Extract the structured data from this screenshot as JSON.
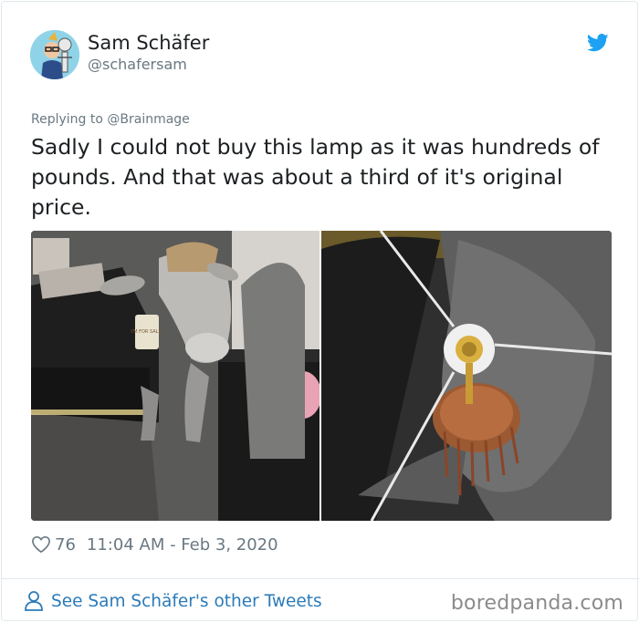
{
  "tweet": {
    "author": {
      "display_name": "Sam Schäfer",
      "handle": "@schafersam",
      "avatar": "avatar-illustration"
    },
    "replying_to": "Replying to @Brainmage",
    "text": "Sadly I could not buy this lamp as it was hundreds of pounds. And that was about a third of it's original price.",
    "media": [
      {
        "icon": "photo-cow-statue",
        "tag_text": "I'M FOR SALE!"
      },
      {
        "icon": "photo-lamp-from-below"
      }
    ],
    "likes": "76",
    "timestamp": "11:04 AM - Feb 3, 2020",
    "icons": {
      "brand": "twitter-bird-icon",
      "like": "heart-icon",
      "profile": "person-icon"
    }
  },
  "footer": {
    "other_tweets_link": "See Sam Schäfer's other Tweets"
  },
  "watermark": "boredpanda.com",
  "colors": {
    "link": "#2b7bb9",
    "text": "#1c2022",
    "secondary_text": "#697882",
    "twitter_blue": "#1da1f2",
    "border": "#e1e8ed"
  }
}
